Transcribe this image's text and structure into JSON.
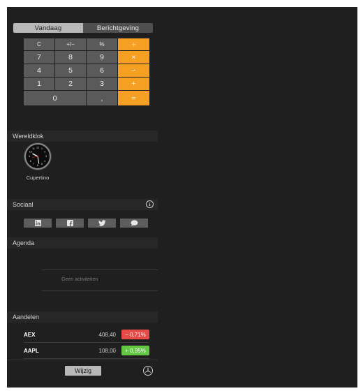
{
  "tabs": [
    {
      "label": "Vandaag",
      "active": true
    },
    {
      "label": "Berichtgeving",
      "active": false
    }
  ],
  "calculator": {
    "keys": [
      [
        "C",
        "+/−",
        "%",
        "÷"
      ],
      [
        "7",
        "8",
        "9",
        "×"
      ],
      [
        "4",
        "5",
        "6",
        "−"
      ],
      [
        "1",
        "2",
        "3",
        "+"
      ],
      [
        "0",
        ",",
        "="
      ]
    ],
    "operator_color": "#f5a023"
  },
  "world_clock": {
    "header": "Wereldklok",
    "city": "Cupertino"
  },
  "social": {
    "header": "Sociaal",
    "icons": [
      "linkedin-icon",
      "facebook-icon",
      "twitter-icon",
      "messages-icon"
    ]
  },
  "agenda": {
    "header": "Agenda",
    "empty_text": "Geen activiteiten"
  },
  "stocks": {
    "header": "Aandelen",
    "rows": [
      {
        "symbol": "AEX",
        "price": "408,40",
        "change": "− 0,71%",
        "direction": "down"
      },
      {
        "symbol": "AAPL",
        "price": "108,00",
        "change": "+ 0,95%",
        "direction": "up"
      }
    ],
    "down_color": "#e84a47",
    "up_color": "#64c744"
  },
  "footer": {
    "edit_label": "Wijzig"
  }
}
